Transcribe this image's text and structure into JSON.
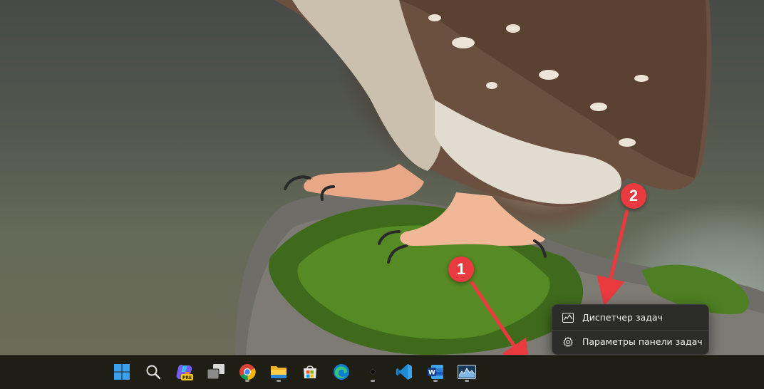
{
  "context_menu": {
    "task_manager_label": "Диспетчер задач",
    "taskbar_settings_label": "Параметры панели задач"
  },
  "annotations": {
    "badge_1": "1",
    "badge_2": "2",
    "color": "#e83a3f"
  },
  "taskbar": {
    "background": "#1e1e14",
    "icons": [
      "windows-start-icon",
      "search-icon",
      "copilot-pre-icon",
      "task-view-icon",
      "chrome-icon",
      "file-explorer-icon",
      "microsoft-store-icon",
      "edge-icon",
      "small-app-icon",
      "vscode-icon",
      "word-icon",
      "task-manager-icon"
    ],
    "copilot_badge": "PRE",
    "word_letter": "W"
  }
}
